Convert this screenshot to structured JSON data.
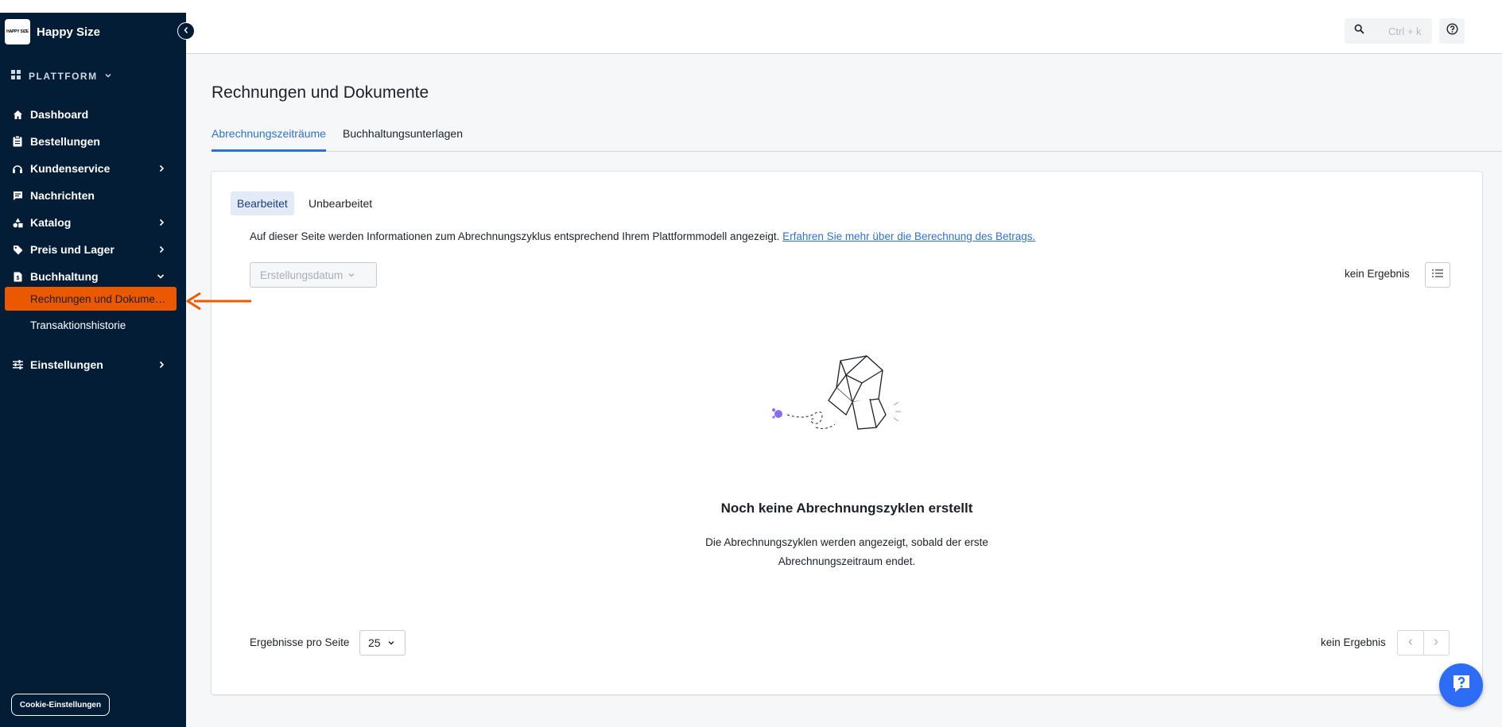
{
  "brand": {
    "logo_text": "HAPPY SIZE",
    "name": "Happy Size"
  },
  "sidebar": {
    "section": "PLATTFORM",
    "items": [
      {
        "label": "Dashboard",
        "icon": "home-icon"
      },
      {
        "label": "Bestellungen",
        "icon": "clipboard-icon"
      },
      {
        "label": "Kundenservice",
        "icon": "headset-icon",
        "has_children": true
      },
      {
        "label": "Nachrichten",
        "icon": "chat-icon"
      },
      {
        "label": "Katalog",
        "icon": "shapes-icon",
        "has_children": true
      },
      {
        "label": "Preis und Lager",
        "icon": "tag-icon",
        "has_children": true
      },
      {
        "label": "Buchhaltung",
        "icon": "document-icon",
        "expanded": true
      }
    ],
    "sub_items": [
      {
        "label": "Rechnungen und Dokume…",
        "active": true
      },
      {
        "label": "Transaktionshistorie",
        "active": false
      }
    ],
    "settings": {
      "label": "Einstellungen",
      "icon": "sliders-icon"
    },
    "cookie_button": "Cookie-Einstellungen",
    "active_color": "#ea5800"
  },
  "topbar": {
    "search_placeholder": "Ctrl + k"
  },
  "main": {
    "title": "Rechnungen und Dokumente",
    "tabs": [
      {
        "label": "Abrechnungszeiträume",
        "active": true
      },
      {
        "label": "Buchhaltungsunterlagen",
        "active": false
      }
    ],
    "segments": [
      {
        "label": "Bearbeitet",
        "active": true
      },
      {
        "label": "Unbearbeitet",
        "active": false
      }
    ],
    "info_text": "Auf dieser Seite werden Informationen zum Abrechnungszyklus entsprechend Ihrem Plattformmodell angezeigt.",
    "info_link": "Erfahren Sie mehr über die Berechnung des Betrags.",
    "date_filter": "Erstellungsdatum",
    "result_count": "kein Ergebnis",
    "empty_title": "Noch keine Abrechnungszyklen erstellt",
    "empty_desc": "Die Abrechnungszyklen werden angezeigt, sobald der erste Abrechnungszeitraum endet.",
    "per_page_label": "Ergebnisse pro Seite",
    "per_page_value": "25",
    "result_count_bottom": "kein Ergebnis"
  },
  "accent_color": "#2d72d2"
}
